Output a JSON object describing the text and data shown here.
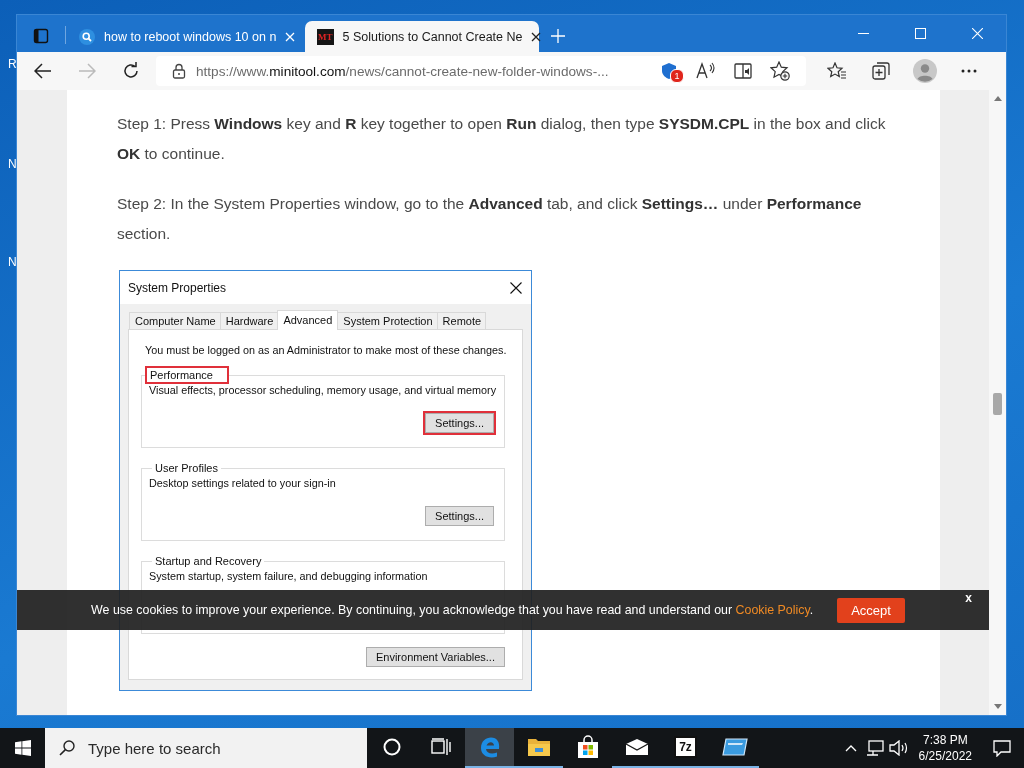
{
  "desktop": {
    "icon_labels": [
      "R",
      "N",
      "N"
    ]
  },
  "browser": {
    "tabs": [
      {
        "title": "how to reboot windows 10 on n",
        "selected": false,
        "favicon": {
          "kind": "search"
        }
      },
      {
        "title": "5 Solutions to Cannot Create Ne",
        "selected": true,
        "favicon": {
          "kind": "logo",
          "text": "MT"
        }
      }
    ],
    "address": {
      "scheme": "https://www.",
      "domain": "minitool.com",
      "path": "/news/cannot-create-new-folder-windows-..."
    },
    "tracker_badge": "1"
  },
  "article": {
    "paragraphs": [
      "Step 1: Press **Windows** key and **R** key together to open **Run** dialog, then type **SYSDM.CPL** in the box and click **OK** to continue.",
      "Step 2: In the System Properties window, go to the **Advanced** tab, and click **Settings…** under **Performance** section."
    ],
    "dialog": {
      "title": "System Properties",
      "tabs": [
        {
          "label": "Computer Name",
          "selected": false
        },
        {
          "label": "Hardware",
          "selected": false
        },
        {
          "label": "Advanced",
          "selected": true
        },
        {
          "label": "System Protection",
          "selected": false
        },
        {
          "label": "Remote",
          "selected": false
        }
      ],
      "notice": "You must be logged on as an Administrator to make most of these changes.",
      "groups": [
        {
          "title": "Performance",
          "description": "Visual effects, processor scheduling, memory usage, and virtual memory",
          "button": "Settings...",
          "highlighted": true
        },
        {
          "title": "User Profiles",
          "description": "Desktop settings related to your sign-in",
          "button": "Settings...",
          "highlighted": false
        },
        {
          "title": "Startup and Recovery",
          "description": "System startup, system failure, and debugging information",
          "highlighted": false
        }
      ],
      "footer_button": "Environment Variables..."
    }
  },
  "cookie_bar": {
    "text": "We use cookies to improve your experience. By continuing, you acknowledge that you have read and understand our ",
    "link": "Cookie Policy",
    "after": ".",
    "accept": "Accept",
    "close": "x"
  },
  "taskbar": {
    "search_placeholder": "Type here to search",
    "apps": [
      {
        "kind": "cortana",
        "active": false,
        "running": false
      },
      {
        "kind": "taskview",
        "active": false,
        "running": false
      },
      {
        "kind": "edge",
        "active": true,
        "running": true
      },
      {
        "kind": "explorer",
        "active": false,
        "running": true
      },
      {
        "kind": "store",
        "active": false,
        "running": false
      },
      {
        "kind": "mail",
        "active": false,
        "running": true
      },
      {
        "kind": "zip",
        "label": "7z",
        "active": false,
        "running": true
      },
      {
        "kind": "app",
        "active": false,
        "running": true
      }
    ],
    "time": "7:38 PM",
    "date": "6/25/2022"
  }
}
